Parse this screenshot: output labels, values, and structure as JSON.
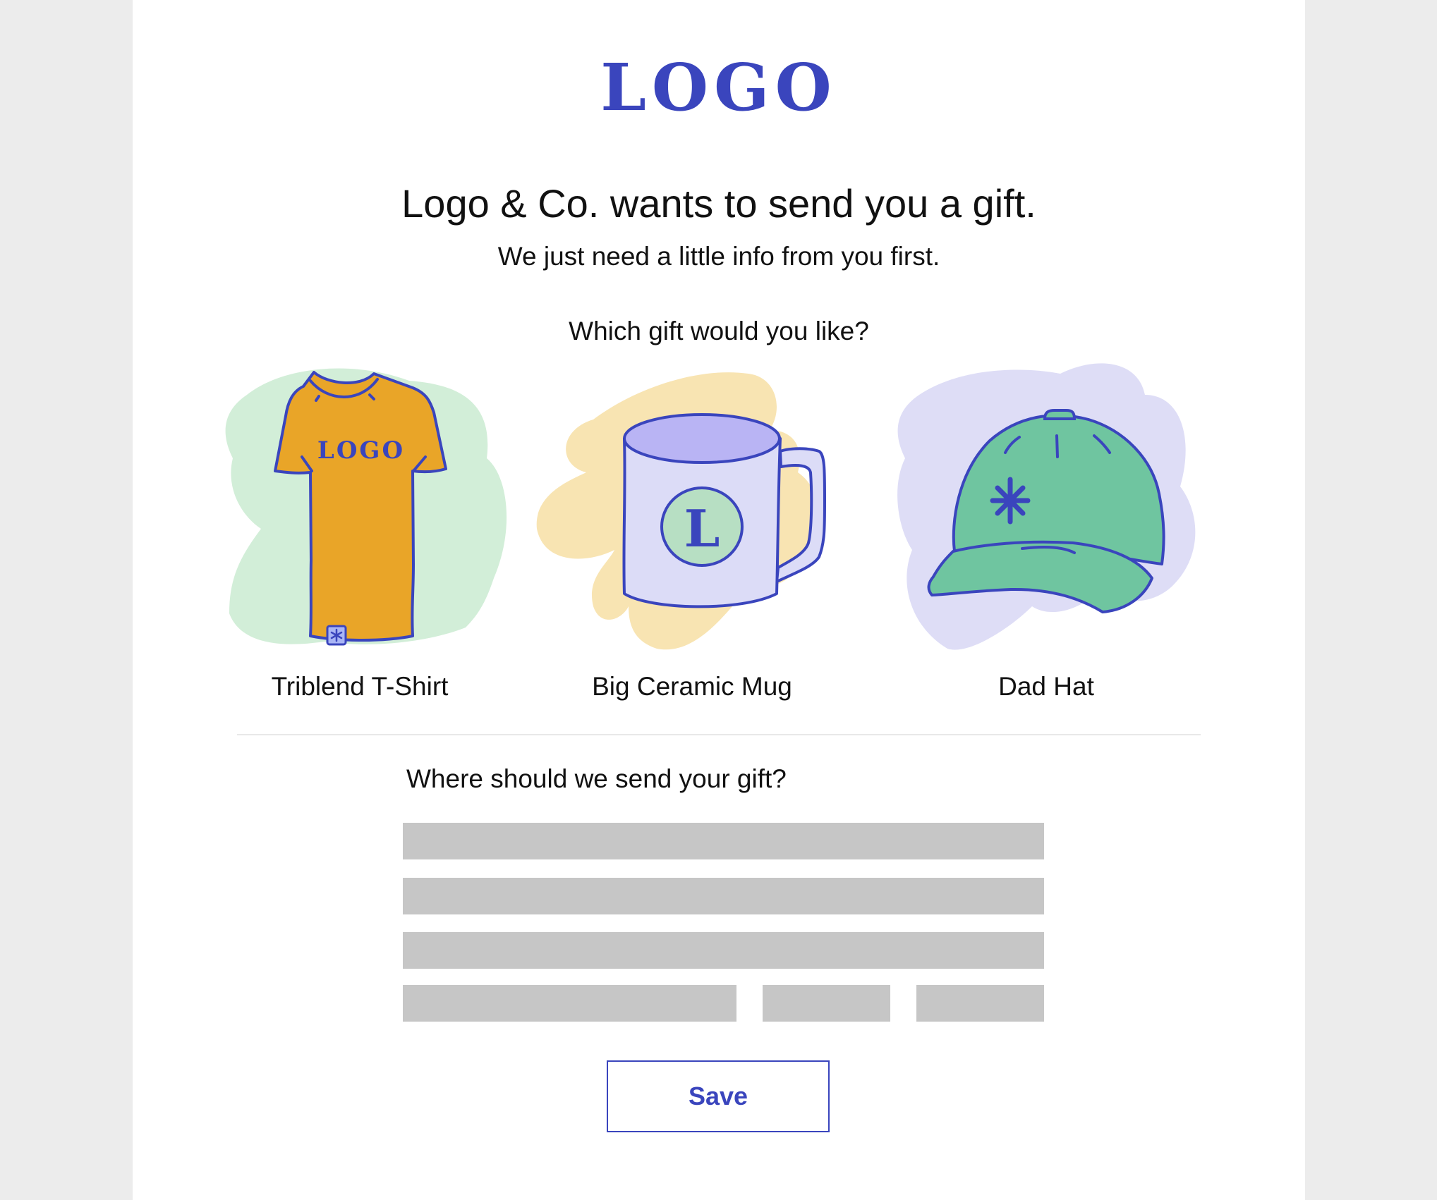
{
  "brand": {
    "logo_text": "LOGO",
    "accent_color": "#3a45bd"
  },
  "header": {
    "headline": "Logo & Co. wants to send you a gift.",
    "subhead": "We just need a little info from you first."
  },
  "gift_section": {
    "question": "Which gift would you like?",
    "options": [
      {
        "label": "Triblend T-Shirt",
        "icon": "t-shirt-icon",
        "print_text": "LOGO",
        "item_color": "#e9a528",
        "blob_color": "#d2eed8"
      },
      {
        "label": "Big Ceramic Mug",
        "icon": "mug-icon",
        "print_text": "L",
        "item_color": "#dcdcf7",
        "blob_color": "#f8e4b2"
      },
      {
        "label": "Dad Hat",
        "icon": "cap-icon",
        "item_color": "#6fc5a0",
        "blob_color": "#deddf6"
      }
    ]
  },
  "address_section": {
    "question": "Where should we send your gift?",
    "field_color": "#c6c6c6"
  },
  "actions": {
    "save_label": "Save"
  }
}
